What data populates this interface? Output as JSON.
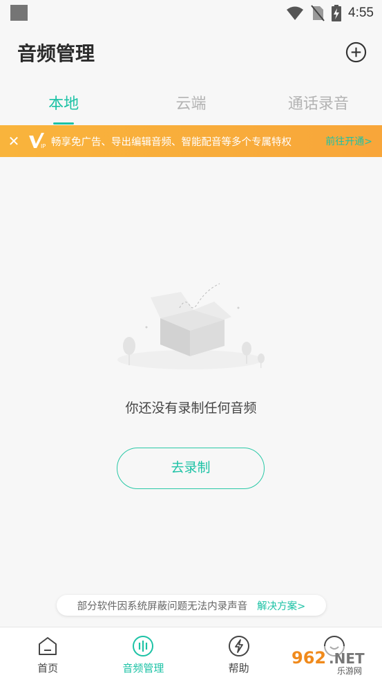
{
  "status_bar": {
    "time": "4:55"
  },
  "header": {
    "title": "音频管理"
  },
  "tabs": [
    {
      "label": "本地",
      "active": true
    },
    {
      "label": "云端",
      "active": false
    },
    {
      "label": "通话录音",
      "active": false
    }
  ],
  "vip_banner": {
    "close_symbol": "✕",
    "text": "畅享免广告、导出编辑音频、智能配音等多个专属特权",
    "link": "前往开通>"
  },
  "empty_state": {
    "message": "你还没有录制任何音频",
    "button_label": "去录制"
  },
  "tip": {
    "text": "部分软件因系统屏蔽问题无法内录声音",
    "link": "解决方案>"
  },
  "bottom_nav": [
    {
      "label": "首页",
      "icon": "home-icon",
      "active": false
    },
    {
      "label": "音频管理",
      "icon": "audio-manage-icon",
      "active": true
    },
    {
      "label": "帮助",
      "icon": "help-icon",
      "active": false
    },
    {
      "label": "",
      "icon": "profile-icon",
      "active": false
    }
  ],
  "watermark": {
    "text": "962.NET",
    "subtext": "乐游网"
  },
  "colors": {
    "accent": "#1cc2a5",
    "banner": "#f8a63a",
    "background": "#f7f7f7"
  }
}
